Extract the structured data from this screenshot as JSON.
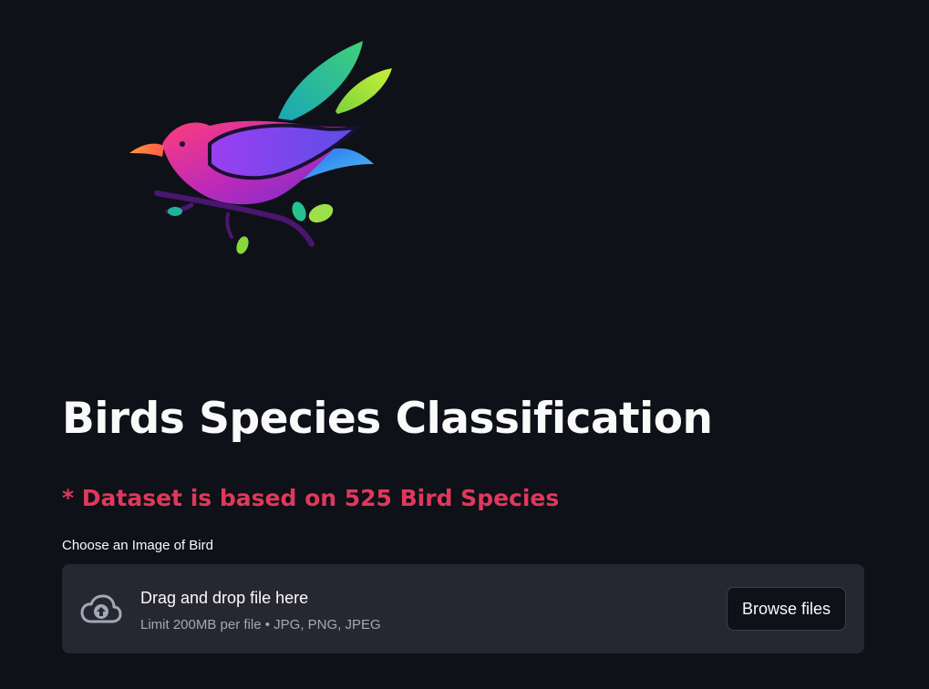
{
  "header": {
    "logo_icon": "colorful-bird-logo-icon"
  },
  "main": {
    "title": "Birds Species Classification",
    "dataset_note": "* Dataset is based on 525 Bird Species",
    "accent_color": "#e0385d"
  },
  "uploader": {
    "label": "Choose an Image of Bird",
    "instruction": "Drag and drop file here",
    "limits": "Limit 200MB per file • JPG, PNG, JPEG",
    "button_label": "Browse files",
    "icon": "cloud-upload-icon"
  }
}
